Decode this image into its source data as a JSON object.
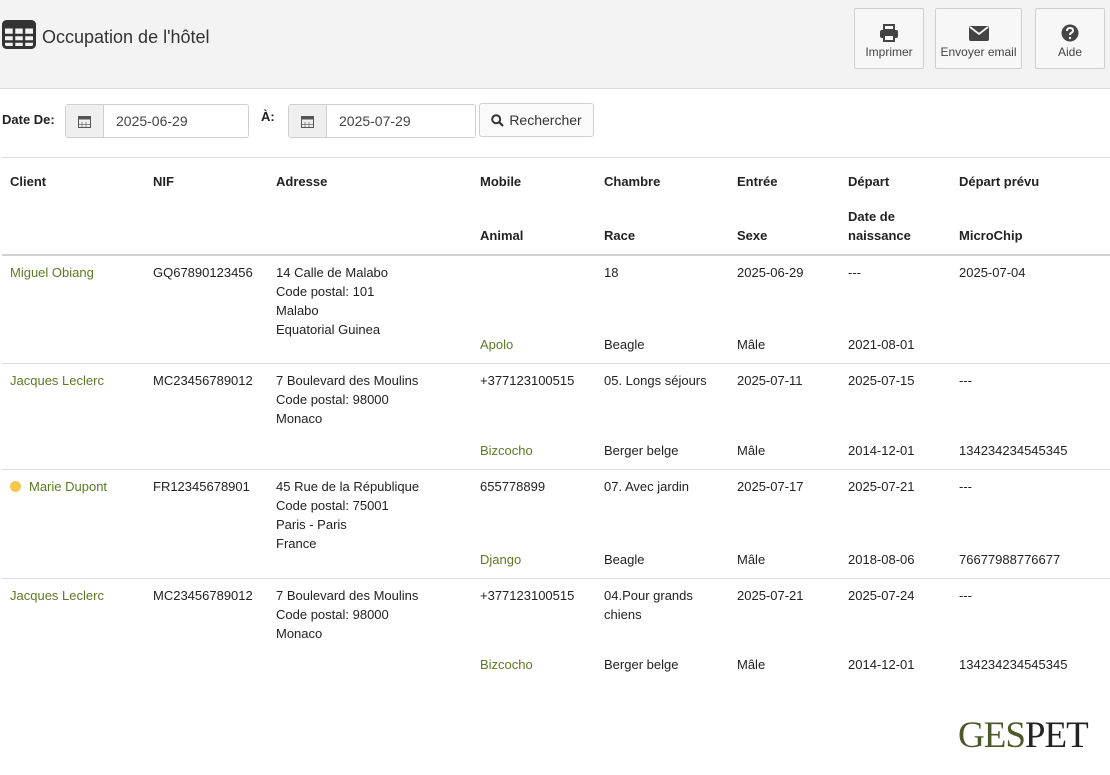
{
  "header": {
    "title": "Occupation de l'hôtel",
    "buttons": {
      "print": "Imprimer",
      "email": "Envoyer email",
      "help": "Aide"
    }
  },
  "filters": {
    "from_label": "Date De:",
    "from_value": "2025-06-29",
    "to_label": "À:",
    "to_value": "2025-07-29",
    "search_label": "Rechercher"
  },
  "table": {
    "headers_top": [
      "Client",
      "NIF",
      "Adresse",
      "Mobile",
      "Chambre",
      "Entrée",
      "Départ",
      "Départ prévu"
    ],
    "headers_bottom": [
      "Animal",
      "Race",
      "Sexe",
      "Date de naissance",
      "MicroChip"
    ],
    "rows": [
      {
        "client": "Miguel Obiang",
        "nif": "GQ67890123456",
        "address": [
          "14 Calle de Malabo",
          "Code postal: 101",
          "Malabo",
          "Equatorial Guinea"
        ],
        "mobile": "",
        "room": [
          "18"
        ],
        "entry": "2025-06-29",
        "departure": "---",
        "planned": "2025-07-04",
        "animal": "Apolo",
        "breed": "Beagle",
        "sex": "Mâle",
        "birth": "2021-08-01",
        "chip": ""
      },
      {
        "client": "Jacques Leclerc",
        "nif": "MC23456789012",
        "address": [
          "7 Boulevard des Moulins",
          "Code postal: 98000",
          "Monaco"
        ],
        "mobile": "+377123100515",
        "room": [
          "05. Longs séjours"
        ],
        "entry": "2025-07-11",
        "departure": "2025-07-15",
        "planned": "---",
        "animal": "Bizcocho",
        "breed": "Berger belge",
        "sex": "Mâle",
        "birth": "2014-12-01",
        "chip": "134234234545345"
      },
      {
        "client": "Marie Dupont",
        "nif": "FR12345678901",
        "status_color": "#f2c94c",
        "address": [
          "45 Rue de la République",
          "Code postal: 75001",
          "Paris - Paris",
          "France"
        ],
        "mobile": "655778899",
        "room": [
          "07. Avec jardin"
        ],
        "entry": "2025-07-17",
        "departure": "2025-07-21",
        "planned": "---",
        "animal": "Django",
        "breed": "Beagle",
        "sex": "Mâle",
        "birth": "2018-08-06",
        "chip": "76677988776677"
      },
      {
        "client": "Jacques Leclerc",
        "nif": "MC23456789012",
        "address": [
          "7 Boulevard des Moulins",
          "Code postal: 98000",
          "Monaco"
        ],
        "mobile": "+377123100515",
        "room": [
          "04.Pour grands",
          "chiens"
        ],
        "entry": "2025-07-21",
        "departure": "2025-07-24",
        "planned": "---",
        "animal": "Bizcocho",
        "breed": "Berger belge",
        "sex": "Mâle",
        "birth": "2014-12-01",
        "chip": "134234234545345"
      }
    ]
  },
  "logo": {
    "part1": "GES",
    "part2": "PET"
  },
  "colors": {
    "link": "#5b7a23",
    "status_dot": "#f2c94c",
    "topbar": "#f3f3f3"
  }
}
